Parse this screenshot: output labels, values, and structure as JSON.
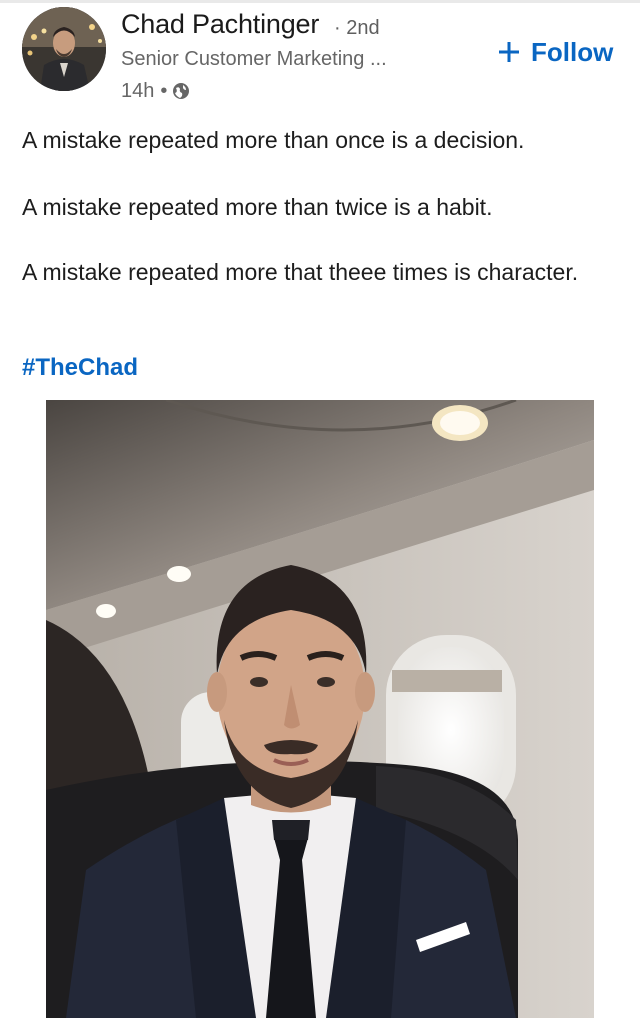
{
  "author": {
    "name": "Chad Pachtinger",
    "degree": "· 2nd",
    "headline": "Senior Customer Marketing ...",
    "time": "14h",
    "visibility_icon": "globe-icon"
  },
  "follow": {
    "icon": "plus-icon",
    "label": "Follow"
  },
  "post": {
    "lines": [
      "A mistake repeated more than once is a decision.",
      "A mistake repeated more than twice is a habit.",
      "A mistake repeated more that theee times is character."
    ],
    "hashtag": "#TheChad"
  },
  "colors": {
    "link_blue": "#0a66c2",
    "text": "#1d1d1d",
    "muted": "#666666"
  }
}
